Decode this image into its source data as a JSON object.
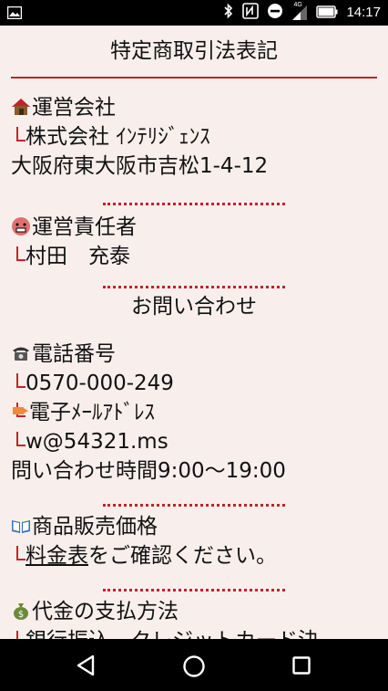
{
  "status_bar": {
    "time": "14:17",
    "network_badge": "4G",
    "icons": [
      "image-icon",
      "bluetooth-icon",
      "nfc-icon",
      "do-not-disturb-icon",
      "signal-icon",
      "battery-icon"
    ]
  },
  "page": {
    "title": "特定商取引法表記"
  },
  "operator": {
    "heading": "運営会社",
    "company": "株式会社 ｲﾝﾃﾘｼﾞｪﾝｽ",
    "address": "大阪府東大阪市吉松1-4-12"
  },
  "manager": {
    "heading": "運営責任者",
    "name": "村田　充泰"
  },
  "contact": {
    "heading": "お問い合わせ",
    "phone_label": "電話番号",
    "phone": "0570-000-249",
    "email_label": "電子ﾒｰﾙｱﾄﾞﾚｽ",
    "email": "w@54321.ms",
    "hours": "問い合わせ時間9:00～19:00"
  },
  "price": {
    "heading": "商品販売価格",
    "link_text": "料金表",
    "suffix": "をご確認ください。"
  },
  "payment": {
    "heading": "代金の支払方法",
    "methods": "銀行振込、クレジットカード決"
  },
  "colors": {
    "accent": "#c8202a",
    "background": "#f8efed"
  }
}
